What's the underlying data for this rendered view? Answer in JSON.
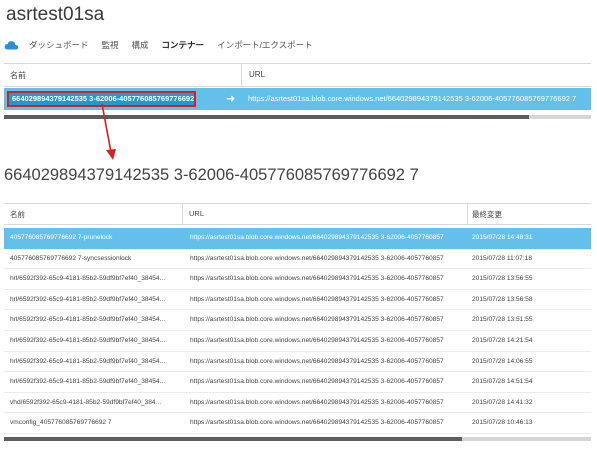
{
  "app_title": "asrtest01sa",
  "nav": {
    "tabs": [
      {
        "label": "ダッシュボード",
        "active": false
      },
      {
        "label": "監視",
        "active": false
      },
      {
        "label": "構成",
        "active": false
      },
      {
        "label": "コンテナー",
        "active": true
      },
      {
        "label": "インポート/エクスポート",
        "active": false
      }
    ]
  },
  "containers": {
    "headers": {
      "name": "名前",
      "url": "URL"
    },
    "rows": [
      {
        "name": "664029894379142535 3-62006-405776085769776692 7",
        "url": "https://asrtest01sa.blob.core.windows.net/664029894379142535 3-62006-405776085769776692 7"
      }
    ]
  },
  "container_title": "664029894379142535 3-62006-405776085769776692 7",
  "blobs": {
    "headers": {
      "name": "名前",
      "url": "URL",
      "modified": "最終変更"
    },
    "rows": [
      {
        "name": "405776085769776692 7-prunelock",
        "url": "https://asrtest01sa.blob.core.windows.net/664029894379142535 3-62006-4057760857",
        "modified": "2015/07/28 14:48:31",
        "selected": true
      },
      {
        "name": "405776085769776692 7-syncsessionlock",
        "url": "https://asrtest01sa.blob.core.windows.net/664029894379142535 3-62006-4057760857",
        "modified": "2015/07/28 11:07:18",
        "selected": false
      },
      {
        "name": "hrl/6592f392-65c9-4181-85b2-59df9bf7ef40_38454...",
        "url": "https://asrtest01sa.blob.core.windows.net/664029894379142535 3-62006-4057760857",
        "modified": "2015/07/28 13:56:55",
        "selected": false
      },
      {
        "name": "hrl/6592f392-65c9-4181-85b2-59df9bf7ef40_38454...",
        "url": "https://asrtest01sa.blob.core.windows.net/664029894379142535 3-62006-4057760857",
        "modified": "2015/07/28 13:56:58",
        "selected": false
      },
      {
        "name": "hrl/6592f392-65c9-4181-85b2-59df9bf7ef40_38454...",
        "url": "https://asrtest01sa.blob.core.windows.net/664029894379142535 3-62006-4057760857",
        "modified": "2015/07/28 13:51:55",
        "selected": false
      },
      {
        "name": "hrl/6592f392-65c9-4181-85b2-59df9bf7ef40_38454...",
        "url": "https://asrtest01sa.blob.core.windows.net/664029894379142535 3-62006-4057760857",
        "modified": "2015/07/28 14:21:54",
        "selected": false
      },
      {
        "name": "hrl/6592f392-65c9-4181-85b2-59df9bf7ef40_38454...",
        "url": "https://asrtest01sa.blob.core.windows.net/664029894379142535 3-62006-4057760857",
        "modified": "2015/07/28 14:06:55",
        "selected": false
      },
      {
        "name": "hrl/6592f392-65c9-4181-85b2-59df9bf7ef40_38454...",
        "url": "https://asrtest01sa.blob.core.windows.net/664029894379142535 3-62006-4057760857",
        "modified": "2015/07/28 14:51:54",
        "selected": false
      },
      {
        "name": "vhd/6592f392-65c9-4181-85b2-59df9bf7ef40_384...",
        "url": "https://asrtest01sa.blob.core.windows.net/664029894379142535 3-62006-4057760857",
        "modified": "2015/07/28 14:41:32",
        "selected": false
      },
      {
        "name": "vmconfig_405776085769776692 7",
        "url": "https://asrtest01sa.blob.core.windows.net/664029894379142535 3-62006-4057760857",
        "modified": "2015/07/28 10:46:13",
        "selected": false
      }
    ]
  },
  "colors": {
    "selected_row": "#62c0ea",
    "selected_cell": "#1f9ad6",
    "highlight_border": "#d9201e",
    "scrollbar_thumb": "#5d5d5d"
  },
  "scroll": {
    "top_thumb_fraction": 0.89,
    "bottom_thumb_fraction": 0.78
  }
}
